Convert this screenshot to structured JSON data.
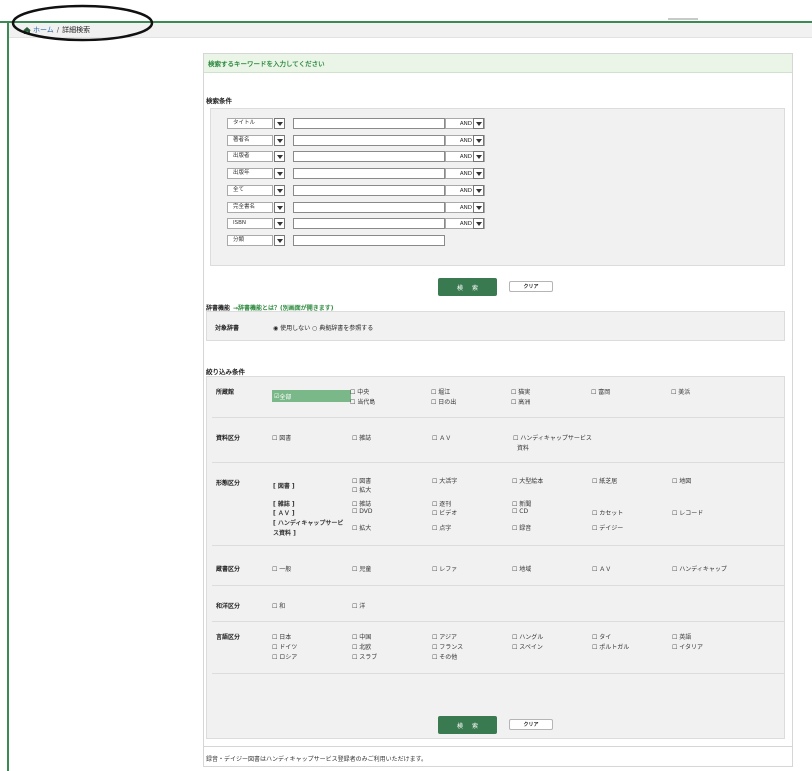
{
  "breadcrumb": {
    "home": "ホーム",
    "separator": "/",
    "current": "詳細検索"
  },
  "panel": {
    "heading": "検索するキーワードを入力してください"
  },
  "criteria": {
    "title": "検索条件",
    "rows": [
      {
        "field": "タイトル",
        "op": "AND"
      },
      {
        "field": "著者名",
        "op": "AND"
      },
      {
        "field": "出版者",
        "op": "AND"
      },
      {
        "field": "出版年",
        "op": "AND"
      },
      {
        "field": "全て",
        "op": "AND"
      },
      {
        "field": "完全書名",
        "op": "AND"
      },
      {
        "field": "ISBN",
        "op": "AND"
      },
      {
        "field": "分類",
        "op": ""
      }
    ]
  },
  "buttons": {
    "search": "検索",
    "clear": "クリア"
  },
  "dictionary": {
    "title": "辞書機能",
    "link": "→辞書機能とは？(別画面が開きます)",
    "label": "対象辞書",
    "options": "◉ 使用しない ○ 典拠辞書を参照する"
  },
  "filters": {
    "title": "絞り込み条件",
    "library": {
      "label": "所蔵館",
      "selected": "全部",
      "options": [
        "中央",
        "当代島",
        "堀江",
        "日の出",
        "猫実",
        "高洲",
        "富岡",
        "美浜"
      ]
    },
    "material": {
      "label": "資料区分",
      "options": [
        "図書",
        "雑誌",
        "ＡＶ",
        "ハンディキャップサービス",
        "資料"
      ]
    },
    "format": {
      "label": "形態区分",
      "groups": [
        "[ 図書 ]",
        "[ 雑誌 ]",
        "[ ＡＶ ]",
        "[ ハンディキャップサービ",
        "ス資料 ]"
      ],
      "options": [
        "図書",
        "拡大",
        "大活字",
        "大型絵本",
        "紙芝居",
        "地図",
        "雑誌",
        "逐刊",
        "新聞",
        "DVD",
        "ビデオ",
        "CD",
        "カセット",
        "レコード",
        "拡大",
        "点字",
        "録音",
        "デイジー"
      ]
    },
    "collection": {
      "label": "蔵書区分",
      "options": [
        "一般",
        "児童",
        "レファ",
        "地域",
        "ＡＶ",
        "ハンディキャップ"
      ]
    },
    "origin": {
      "label": "和洋区分",
      "options": [
        "和",
        "洋"
      ]
    },
    "language": {
      "label": "言語区分",
      "options": [
        "日本",
        "ドイツ",
        "ロシア",
        "中国",
        "北欧",
        "スラブ",
        "アジア",
        "フランス",
        "その他",
        "ハングル",
        "スペイン",
        "タイ",
        "ポルトガル",
        "英語",
        "イタリア"
      ]
    }
  },
  "footnote": "録音・デイジー図書はハンディキャップサービス登録者のみご利用いただけます。",
  "colors": {
    "accent": "#3a8a55",
    "button": "#3a7a50",
    "panel_head": "#eaf5e8",
    "link": "#2d8a3e"
  }
}
